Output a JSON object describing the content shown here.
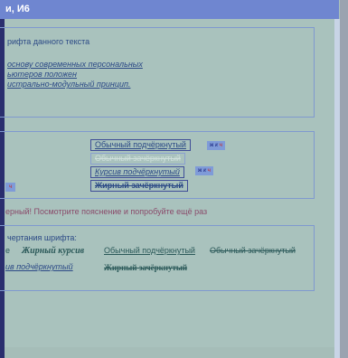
{
  "window": {
    "title": "и, И6"
  },
  "section1": {
    "heading": "рифта данного текста",
    "lines": [
      "основу современных персональных",
      "ьютеров положен",
      "истрально-модульный принцип."
    ]
  },
  "section2": {
    "options": [
      "Обычный подчёркнутый",
      "Обычный зачёркнутый",
      "Курсив подчёркнутый",
      "Жирный зачёркнутый"
    ],
    "chip1": {
      "a": "ж",
      "b": "к",
      "c": "ч"
    },
    "chip2": {
      "a": "ж",
      "b": "к",
      "c": "ч"
    },
    "chip_left": "ч"
  },
  "message": "ерный! Посмотрите пояснение и попробуйте ещё раз",
  "section3": {
    "heading": "чертания шрифта:",
    "row1": [
      "е",
      "Жирный курсив",
      "Обычный подчёркнутый",
      "Обычный зачёркнутый"
    ],
    "row2": [
      "ив подчёркнутый",
      "Жирный зачёркнутый"
    ]
  }
}
